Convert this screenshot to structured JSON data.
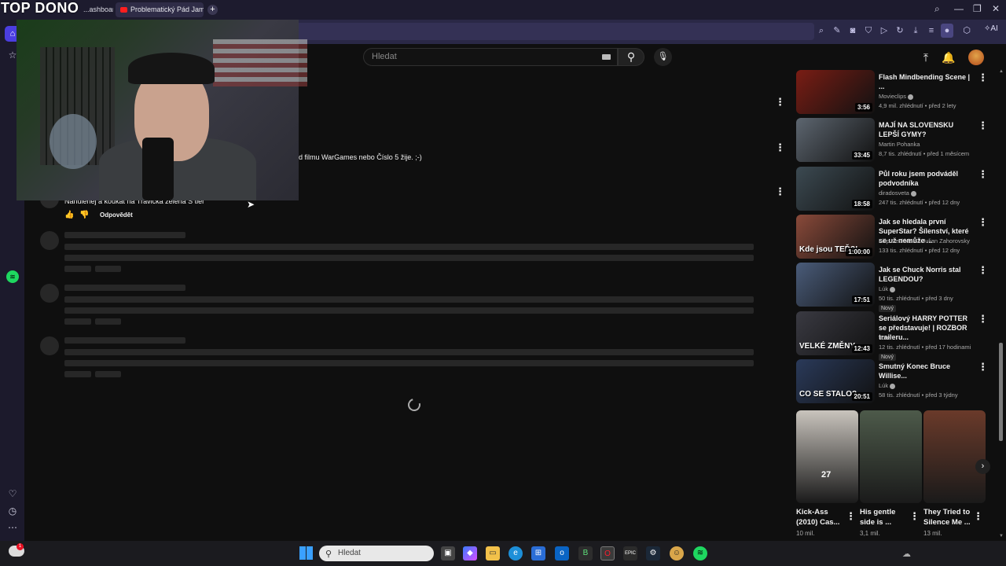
{
  "overlay_title": "TOP DONO",
  "tabs": [
    {
      "label": "...ashboard"
    },
    {
      "label": "Problematický Pád James"
    }
  ],
  "new_tab": "+",
  "window_controls": [
    "⌕",
    "—",
    "❐",
    "✕"
  ],
  "ai_button": "AI",
  "search": {
    "placeholder": "Hledat"
  },
  "comments": {
    "partial_text": "d filmu WarGames nebo Číslo 5 žije. ;-)",
    "visible_comment": "Nahulenej a koukat na Travička zelená S tier",
    "reply_label": "Odpovědět"
  },
  "recommendations": [
    {
      "title": "Flash Mindbending Scene | ...",
      "channel": "Movieclips",
      "verified": true,
      "meta": "4,9 mil. zhlédnutí • před 2 lety",
      "duration": "3:56",
      "badge": "",
      "thumb_text": "",
      "color": "#7a1d14"
    },
    {
      "title": "MAJÍ NA SLOVENSKU LEPŠÍ GYMY?",
      "channel": "Martin Pohanka",
      "verified": false,
      "meta": "8,7 tis. zhlédnutí • před 1 měsícem",
      "duration": "33:45",
      "badge": "",
      "thumb_text": "",
      "color": "#5d6670"
    },
    {
      "title": "Půl roku jsem podváděl podvodníka",
      "channel": "diradosveta",
      "verified": true,
      "meta": "247 tis. zhlédnutí • před 12 dny",
      "duration": "18:58",
      "badge": "",
      "thumb_text": "",
      "color": "#3c4a52"
    },
    {
      "title": "Jak se hledala první SuperStar? Šílenství, které se už nemůže ...",
      "channel": "Filip Nesládek a Julian Zahorovsky",
      "verified": false,
      "meta": "133 tis. zhlédnutí • před 12 dny",
      "duration": "1:00:00",
      "badge": "",
      "thumb_text": "Kde jsou TEĎ?!",
      "color": "#8a4a3a"
    },
    {
      "title": "Jak se Chuck Norris stal LEGENDOU?",
      "channel": "Lúk",
      "verified": true,
      "meta": "50 tis. zhlédnutí • před 3 dny",
      "duration": "17:51",
      "badge": "Nový",
      "thumb_text": "",
      "color": "#4a5c7a"
    },
    {
      "title": "Seriálový HARRY POTTER se představuje! | ROZBOR traileru...",
      "channel": "Toren",
      "verified": false,
      "meta": "12 tis. zhlédnutí • před 17 hodinami",
      "duration": "12:43",
      "badge": "Nový",
      "thumb_text": "VELKÉ ZMĚNY",
      "color": "#3a3a42"
    },
    {
      "title": "Smutný Konec Bruce Willise...",
      "channel": "Lúk",
      "verified": true,
      "meta": "58 tis. zhlédnutí • před 3 týdny",
      "duration": "20:51",
      "badge": "",
      "thumb_text": "CO SE STALO?",
      "color": "#2a3a5a"
    }
  ],
  "shorts": [
    {
      "title": "Kick-Ass (2010) Cas...",
      "views": "10 mil.",
      "overlay": "27",
      "color": "#c9c4bd"
    },
    {
      "title": "His gentle side is ...",
      "views": "3,1 mil.",
      "overlay": "",
      "color": "#4d5a4a"
    },
    {
      "title": "They Tried to Silence Me ...",
      "views": "13 mil.",
      "overlay": "",
      "color": "#6a3a2a"
    }
  ],
  "taskbar": {
    "search_placeholder": "Hledat"
  },
  "colors": {
    "accent": "#4b3ee0",
    "youtube_red": "#ff1e1e",
    "spotify": "#1ed760"
  }
}
